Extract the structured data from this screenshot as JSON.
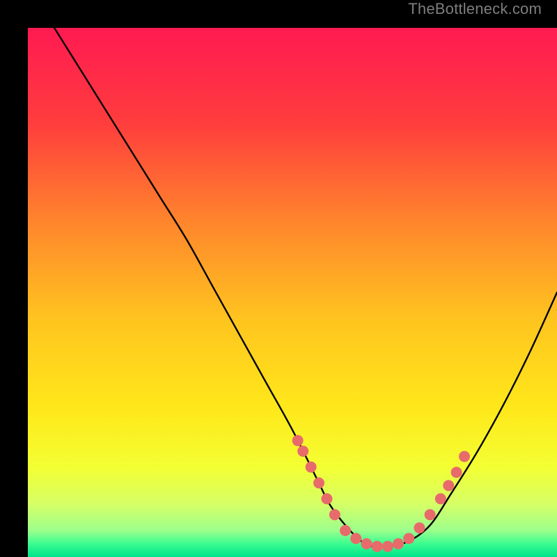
{
  "watermark": "TheBottleneck.com",
  "chart_data": {
    "type": "line",
    "title": "",
    "xlabel": "",
    "ylabel": "",
    "xlim": [
      0,
      100
    ],
    "ylim": [
      0,
      100
    ],
    "grid": false,
    "legend": false,
    "gradient_stops": [
      {
        "offset": 0,
        "color": "#ff1a52"
      },
      {
        "offset": 0.18,
        "color": "#ff3d3d"
      },
      {
        "offset": 0.38,
        "color": "#ff8a2b"
      },
      {
        "offset": 0.55,
        "color": "#ffc41f"
      },
      {
        "offset": 0.72,
        "color": "#ffe81a"
      },
      {
        "offset": 0.83,
        "color": "#f3ff33"
      },
      {
        "offset": 0.9,
        "color": "#d6ff66"
      },
      {
        "offset": 0.95,
        "color": "#9cff8c"
      },
      {
        "offset": 0.975,
        "color": "#3bfc90"
      },
      {
        "offset": 1.0,
        "color": "#00e28a"
      }
    ],
    "series": [
      {
        "name": "bottleneck-curve",
        "x": [
          5,
          10,
          15,
          20,
          25,
          30,
          35,
          40,
          45,
          50,
          55,
          57,
          60,
          63,
          65,
          68,
          72,
          76,
          80,
          85,
          90,
          95,
          100
        ],
        "y": [
          100,
          92,
          84,
          76,
          68,
          60,
          51,
          42,
          33,
          24,
          14,
          10,
          6,
          3,
          2,
          2,
          3,
          6,
          12,
          20,
          29,
          39,
          50
        ]
      }
    ],
    "markers": {
      "name": "highlight-points",
      "color": "#e86b6b",
      "radius": 8,
      "points": [
        {
          "x": 51,
          "y": 22
        },
        {
          "x": 52,
          "y": 20
        },
        {
          "x": 53.5,
          "y": 17
        },
        {
          "x": 55,
          "y": 14
        },
        {
          "x": 56.5,
          "y": 11
        },
        {
          "x": 58,
          "y": 8
        },
        {
          "x": 60,
          "y": 5
        },
        {
          "x": 62,
          "y": 3.5
        },
        {
          "x": 64,
          "y": 2.5
        },
        {
          "x": 66,
          "y": 2
        },
        {
          "x": 68,
          "y": 2
        },
        {
          "x": 70,
          "y": 2.5
        },
        {
          "x": 72,
          "y": 3.5
        },
        {
          "x": 74,
          "y": 5.5
        },
        {
          "x": 76,
          "y": 8
        },
        {
          "x": 78,
          "y": 11
        },
        {
          "x": 79.5,
          "y": 13.5
        },
        {
          "x": 81,
          "y": 16
        },
        {
          "x": 82.5,
          "y": 19
        }
      ]
    }
  }
}
